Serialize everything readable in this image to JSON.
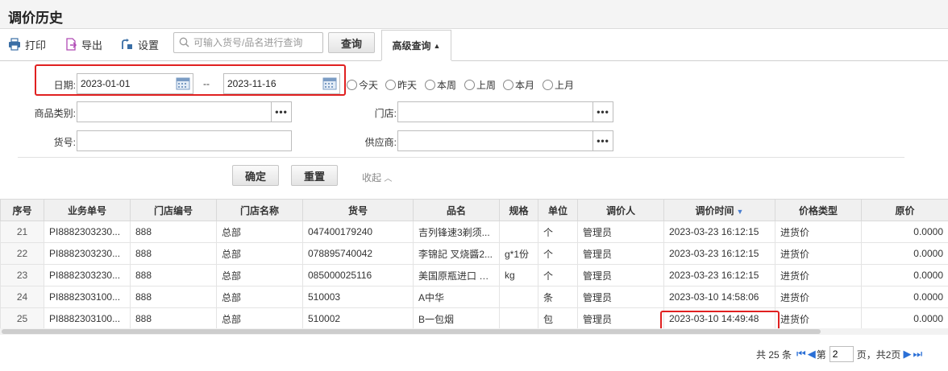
{
  "page": {
    "title": "调价历史"
  },
  "toolbar": {
    "print_label": "打印",
    "export_label": "导出",
    "settings_label": "设置",
    "search_placeholder": "可输入货号/品名进行查询",
    "search_value": "",
    "query_label": "查询",
    "advanced_label": "高级查询"
  },
  "filters": {
    "date_label": "日期:",
    "date_from": "2023-01-01",
    "date_sep": "--",
    "date_to": "2023-11-16",
    "radios": [
      "今天",
      "昨天",
      "本周",
      "上周",
      "本月",
      "上月"
    ],
    "category_label": "商品类别:",
    "category_value": "",
    "store_label": "门店:",
    "store_value": "",
    "item_no_label": "货号:",
    "item_no_value": "",
    "supplier_label": "供应商:",
    "supplier_value": "",
    "dots": "•••",
    "confirm_label": "确定",
    "reset_label": "重置",
    "collapse_label": "收起"
  },
  "table": {
    "headers": [
      "序号",
      "业务单号",
      "门店编号",
      "门店名称",
      "货号",
      "品名",
      "规格",
      "单位",
      "调价人",
      "调价时间",
      "价格类型",
      "原价"
    ],
    "rows": [
      [
        "21",
        "PI8882303230...",
        "888",
        "总部",
        "047400179240",
        "吉列锋速3剃须...",
        "",
        "个",
        "管理员",
        "2023-03-23 16:12:15",
        "进货价",
        "0.0000"
      ],
      [
        "22",
        "PI8882303230...",
        "888",
        "总部",
        "078895740042",
        "李锦記 叉烧醬2...",
        "g*1份",
        "个",
        "管理员",
        "2023-03-23 16:12:15",
        "进货价",
        "0.0000"
      ],
      [
        "23",
        "PI8882303230...",
        "888",
        "总部",
        "085000025116",
        "美国原瓶进口 加...",
        "kg",
        "个",
        "管理员",
        "2023-03-23 16:12:15",
        "进货价",
        "0.0000"
      ],
      [
        "24",
        "PI8882303100...",
        "888",
        "总部",
        "510003",
        "A中华",
        "",
        "条",
        "管理员",
        "2023-03-10 14:58:06",
        "进货价",
        "0.0000"
      ],
      [
        "25",
        "PI8882303100...",
        "888",
        "总部",
        "510002",
        "B一包烟",
        "",
        "包",
        "管理员",
        "2023-03-10 14:49:48",
        "进货价",
        "0.0000"
      ]
    ]
  },
  "pager": {
    "total_text": "共 25 条",
    "page_prefix": "第",
    "page_value": "2",
    "page_suffix": "页，共2页"
  },
  "colors": {
    "highlight_red": "#e02020",
    "accent_blue": "#2a6fd6"
  }
}
